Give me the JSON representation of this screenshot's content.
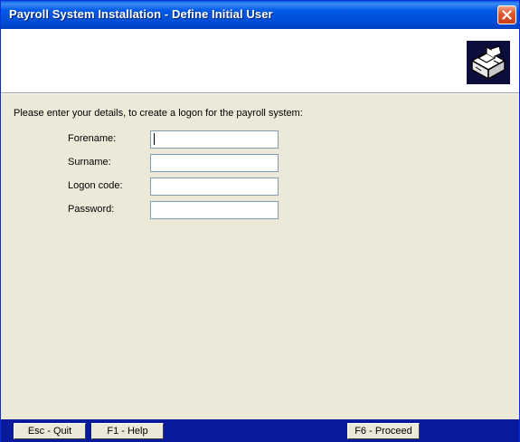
{
  "window": {
    "title": "Payroll System Installation - Define Initial User"
  },
  "header": {
    "logo_icon": "installer-box-icon"
  },
  "form": {
    "intro": "Please enter your details, to create a logon for the payroll system:",
    "fields": [
      {
        "label": "Forename:",
        "value": ""
      },
      {
        "label": "Surname:",
        "value": ""
      },
      {
        "label": "Logon code:",
        "value": ""
      },
      {
        "label": "Password:",
        "value": ""
      }
    ]
  },
  "statusbar": {
    "keys": [
      {
        "label": "Esc - Quit"
      },
      {
        "label": "F1 - Help"
      },
      {
        "label": "F6 - Proceed"
      }
    ]
  },
  "colors": {
    "titlebar": "#0058e6",
    "close_button": "#e2582f",
    "background": "#ece9d8",
    "statusbar": "#0a1a9c",
    "input_border": "#7f9db9"
  }
}
